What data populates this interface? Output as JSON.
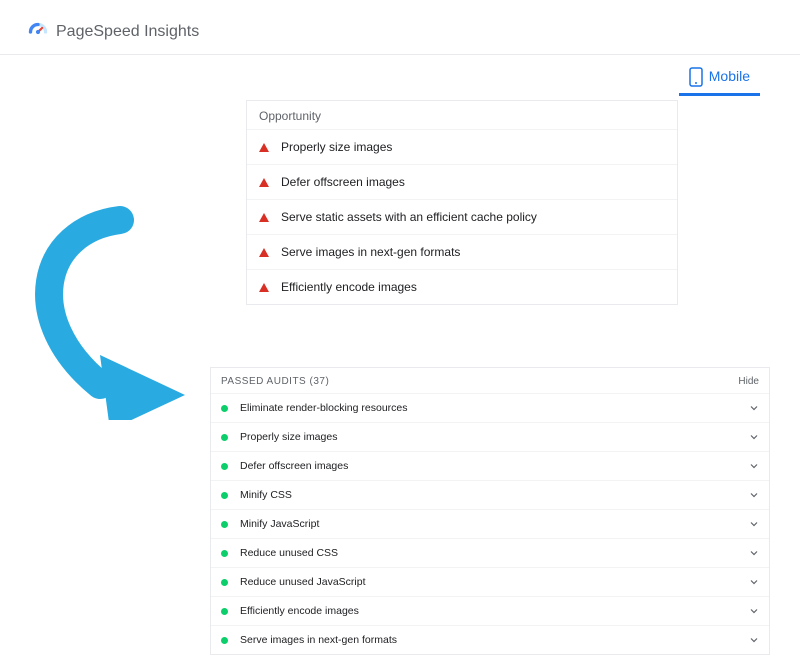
{
  "header": {
    "title": "PageSpeed Insights"
  },
  "tab": {
    "label": "Mobile"
  },
  "opportunity": {
    "heading": "Opportunity",
    "items": [
      {
        "label": "Properly size images"
      },
      {
        "label": "Defer offscreen images"
      },
      {
        "label": "Serve static assets with an efficient cache policy"
      },
      {
        "label": "Serve images in next-gen formats"
      },
      {
        "label": "Efficiently encode images"
      }
    ]
  },
  "passed": {
    "title": "PASSED AUDITS (37)",
    "hide": "Hide",
    "items": [
      {
        "label": "Eliminate render-blocking resources"
      },
      {
        "label": "Properly size images"
      },
      {
        "label": "Defer offscreen images"
      },
      {
        "label": "Minify CSS"
      },
      {
        "label": "Minify JavaScript"
      },
      {
        "label": "Reduce unused CSS"
      },
      {
        "label": "Reduce unused JavaScript"
      },
      {
        "label": "Efficiently encode images"
      },
      {
        "label": "Serve images in next-gen formats"
      }
    ]
  }
}
